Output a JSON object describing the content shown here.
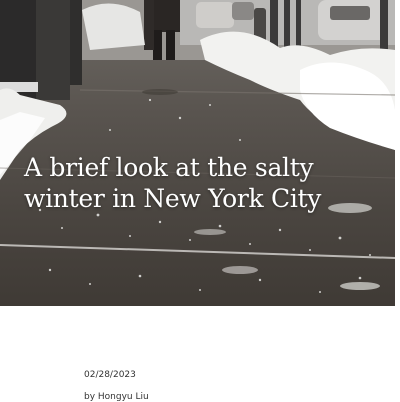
{
  "article": {
    "title": "A brief look at the salty winter in New York City",
    "date": "02/28/2023",
    "byline": "by Hongyu Liu"
  },
  "hero_image": {
    "subject": "salted sidewalk with snow banks",
    "accent_colors": [
      "#f4f4f2",
      "#5a5550",
      "#3f3a35"
    ]
  }
}
